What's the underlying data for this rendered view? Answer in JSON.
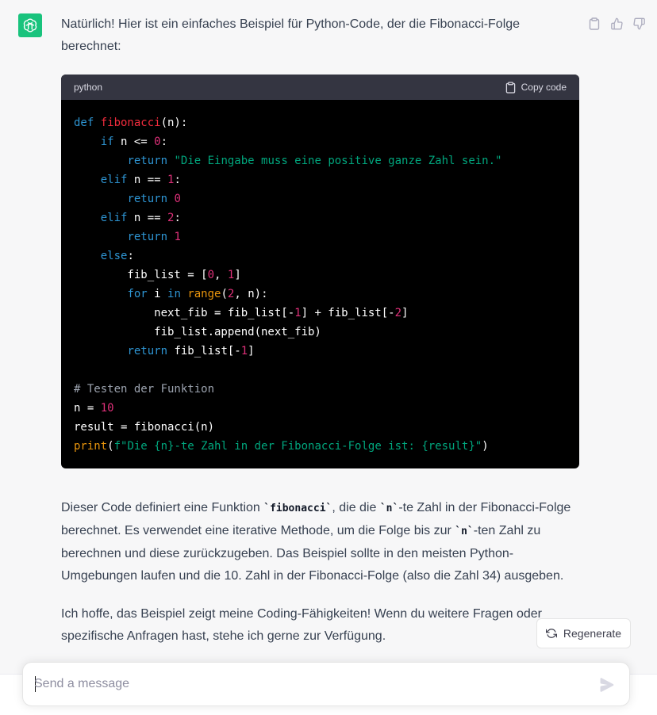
{
  "assistant": {
    "avatar_icon": "openai-logo-icon",
    "avatar_color": "#19c37d"
  },
  "message": {
    "intro": "Natürlich! Hier ist ein einfaches Beispiel für Python-Code, der die Fibonacci-Folge berechnet:",
    "code": {
      "language": "python",
      "copy_label": "Copy code",
      "lines": [
        [
          {
            "t": "def ",
            "c": "kw"
          },
          {
            "t": "fibonacci",
            "c": "fn"
          },
          {
            "t": "(n):",
            "c": ""
          }
        ],
        [
          {
            "t": "    ",
            "c": ""
          },
          {
            "t": "if",
            "c": "kw"
          },
          {
            "t": " n <= ",
            "c": ""
          },
          {
            "t": "0",
            "c": "num"
          },
          {
            "t": ":",
            "c": ""
          }
        ],
        [
          {
            "t": "        ",
            "c": ""
          },
          {
            "t": "return ",
            "c": "kw"
          },
          {
            "t": "\"Die Eingabe muss eine positive ganze Zahl sein.\"",
            "c": "str"
          }
        ],
        [
          {
            "t": "    ",
            "c": ""
          },
          {
            "t": "elif",
            "c": "kw"
          },
          {
            "t": " n == ",
            "c": ""
          },
          {
            "t": "1",
            "c": "num"
          },
          {
            "t": ":",
            "c": ""
          }
        ],
        [
          {
            "t": "        ",
            "c": ""
          },
          {
            "t": "return ",
            "c": "kw"
          },
          {
            "t": "0",
            "c": "num"
          }
        ],
        [
          {
            "t": "    ",
            "c": ""
          },
          {
            "t": "elif",
            "c": "kw"
          },
          {
            "t": " n == ",
            "c": ""
          },
          {
            "t": "2",
            "c": "num"
          },
          {
            "t": ":",
            "c": ""
          }
        ],
        [
          {
            "t": "        ",
            "c": ""
          },
          {
            "t": "return ",
            "c": "kw"
          },
          {
            "t": "1",
            "c": "num"
          }
        ],
        [
          {
            "t": "    ",
            "c": ""
          },
          {
            "t": "else",
            "c": "kw"
          },
          {
            "t": ":",
            "c": ""
          }
        ],
        [
          {
            "t": "        fib_list = [",
            "c": ""
          },
          {
            "t": "0",
            "c": "num"
          },
          {
            "t": ", ",
            "c": ""
          },
          {
            "t": "1",
            "c": "num"
          },
          {
            "t": "]",
            "c": ""
          }
        ],
        [
          {
            "t": "        ",
            "c": ""
          },
          {
            "t": "for",
            "c": "kw"
          },
          {
            "t": " i ",
            "c": ""
          },
          {
            "t": "in",
            "c": "kw"
          },
          {
            "t": " ",
            "c": ""
          },
          {
            "t": "range",
            "c": "bi"
          },
          {
            "t": "(",
            "c": ""
          },
          {
            "t": "2",
            "c": "num"
          },
          {
            "t": ", n):",
            "c": ""
          }
        ],
        [
          {
            "t": "            next_fib = fib_list[-",
            "c": ""
          },
          {
            "t": "1",
            "c": "num"
          },
          {
            "t": "] + fib_list[-",
            "c": ""
          },
          {
            "t": "2",
            "c": "num"
          },
          {
            "t": "]",
            "c": ""
          }
        ],
        [
          {
            "t": "            fib_list.append(next_fib)",
            "c": ""
          }
        ],
        [
          {
            "t": "        ",
            "c": ""
          },
          {
            "t": "return",
            "c": "kw"
          },
          {
            "t": " fib_list[-",
            "c": ""
          },
          {
            "t": "1",
            "c": "num"
          },
          {
            "t": "]",
            "c": ""
          }
        ],
        [
          {
            "t": "",
            "c": ""
          }
        ],
        [
          {
            "t": "# Testen der Funktion",
            "c": "cm"
          }
        ],
        [
          {
            "t": "n = ",
            "c": ""
          },
          {
            "t": "10",
            "c": "num"
          }
        ],
        [
          {
            "t": "result = fibonacci(n)",
            "c": ""
          }
        ],
        [
          {
            "t": "print",
            "c": "bi"
          },
          {
            "t": "(",
            "c": ""
          },
          {
            "t": "f\"Die {n}-te Zahl in der Fibonacci-Folge ist: {result}\"",
            "c": "str"
          },
          {
            "t": ")",
            "c": ""
          }
        ]
      ]
    },
    "explanation_parts": [
      {
        "t": "Dieser Code definiert eine Funktion ",
        "code": false
      },
      {
        "t": "`fibonacci`",
        "code": true
      },
      {
        "t": ", die die ",
        "code": false
      },
      {
        "t": "`n`",
        "code": true
      },
      {
        "t": "-te Zahl in der Fibonacci-Folge berechnet. Es verwendet eine iterative Methode, um die Folge bis zur ",
        "code": false
      },
      {
        "t": "`n`",
        "code": true
      },
      {
        "t": "-ten Zahl zu berechnen und diese zurückzugeben. Das Beispiel sollte in den meisten Python-Umgebungen laufen und die 10. Zahl in der Fibonacci-Folge (also die Zahl 34) ausgeben.",
        "code": false
      }
    ],
    "closing": "Ich hoffe, das Beispiel zeigt meine Coding-Fähigkeiten! Wenn du weitere Fragen oder spezifische Anfragen hast, stehe ich gerne zur Verfügung."
  },
  "actions": {
    "copy_icon": "clipboard-icon",
    "like_icon": "thumbs-up-icon",
    "dislike_icon": "thumbs-down-icon"
  },
  "regenerate": {
    "label": "Regenerate",
    "icon": "refresh-icon"
  },
  "composer": {
    "placeholder": "Send a message",
    "value": "",
    "send_icon": "paper-plane-icon"
  }
}
